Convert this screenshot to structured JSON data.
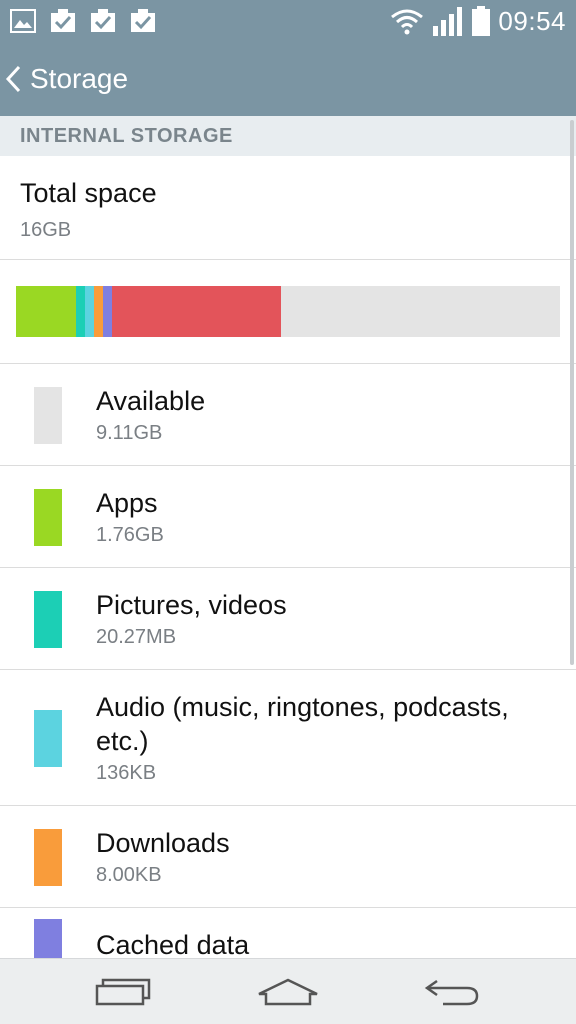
{
  "status_bar": {
    "left_icons": [
      "image-icon",
      "task-check-icon",
      "task-check-icon",
      "task-check-icon"
    ],
    "right_icons": [
      "wifi-icon",
      "signal-icon",
      "battery-icon"
    ],
    "time": "09:54"
  },
  "app_bar": {
    "back_icon": "chevron-left-icon",
    "title": "Storage",
    "color": "#7b95a3"
  },
  "section": {
    "header": "INTERNAL STORAGE"
  },
  "total": {
    "label": "Total space",
    "value": "16GB"
  },
  "usage_bar": {
    "track_color": "#e4e4e4",
    "segments": [
      {
        "name": "Apps",
        "fraction": 0.11,
        "color": "#9ad823"
      },
      {
        "name": "Pictures, videos",
        "fraction": 0.017,
        "color": "#1ccfb5"
      },
      {
        "name": "Audio",
        "fraction": 0.017,
        "color": "#5cd3e0"
      },
      {
        "name": "Downloads",
        "fraction": 0.017,
        "color": "#f99c3b"
      },
      {
        "name": "Cached data",
        "fraction": 0.017,
        "color": "#7f7fe0"
      },
      {
        "name": "Misc",
        "fraction": 0.311,
        "color": "#e3545a"
      }
    ]
  },
  "items": [
    {
      "title": "Available",
      "size": "9.11GB",
      "color": "#e4e4e4"
    },
    {
      "title": "Apps",
      "size": "1.76GB",
      "color": "#9ad823"
    },
    {
      "title": "Pictures, videos",
      "size": "20.27MB",
      "color": "#1ccfb5"
    },
    {
      "title": "Audio (music, ringtones, podcasts, etc.)",
      "size": "136KB",
      "color": "#5cd3e0"
    },
    {
      "title": "Downloads",
      "size": "8.00KB",
      "color": "#f99c3b"
    },
    {
      "title": "Cached data",
      "size": "",
      "color": "#7f7fe0"
    }
  ],
  "nav_bar": {
    "buttons": [
      "recent-apps-icon",
      "home-icon",
      "back-icon"
    ]
  }
}
